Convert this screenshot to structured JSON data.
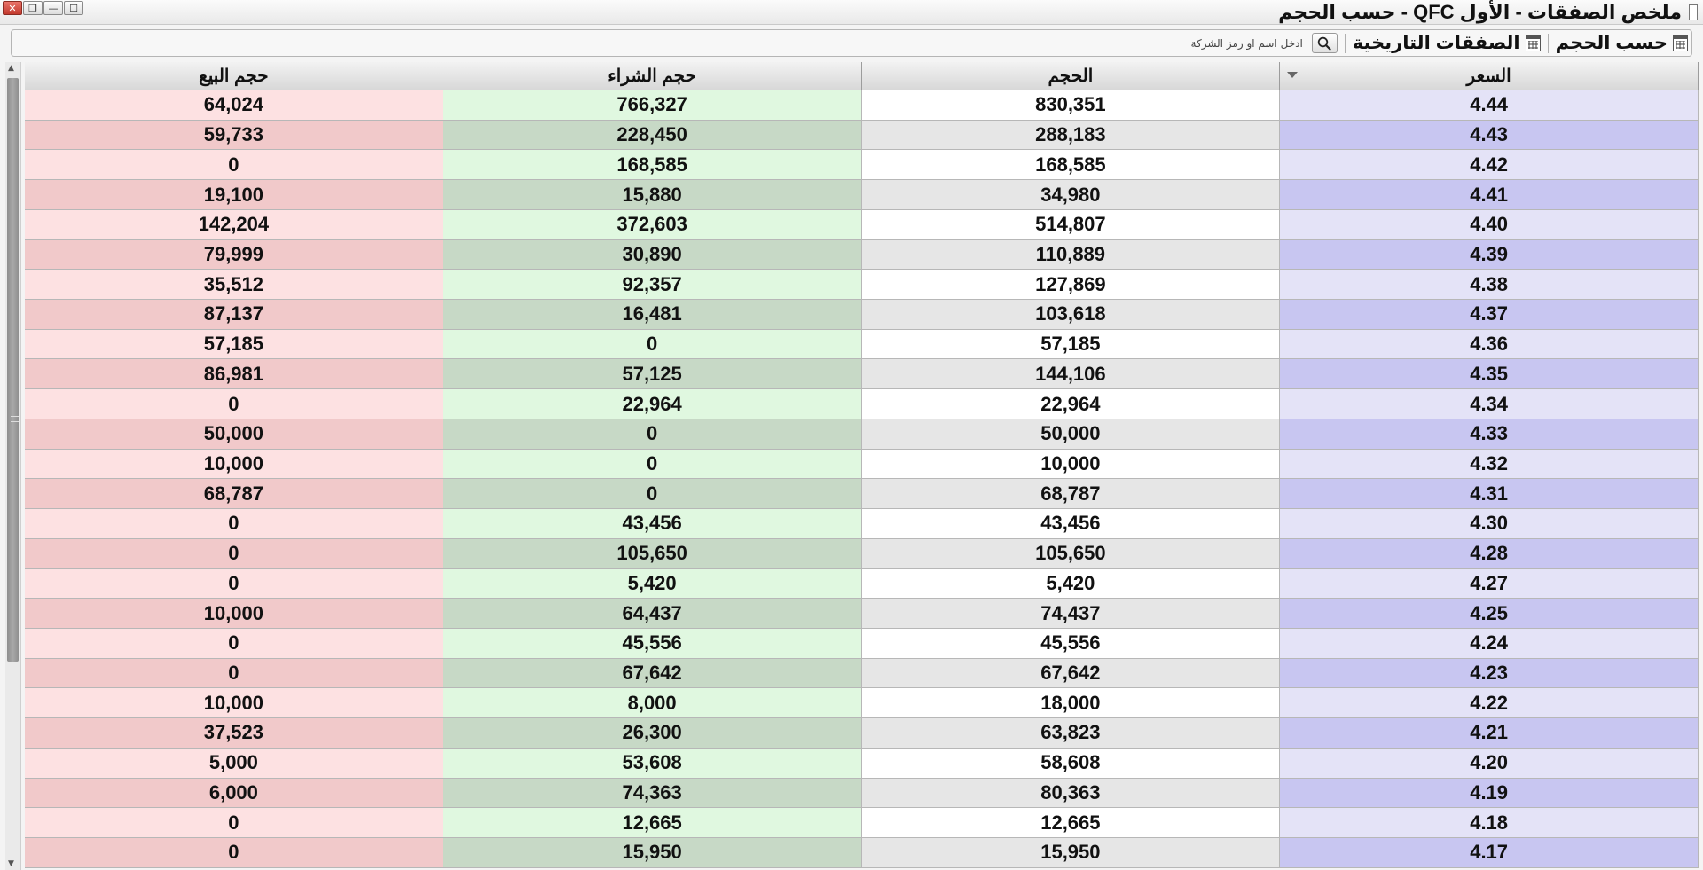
{
  "window": {
    "title": "ملخص الصفقات - الأول QFC - حسب الحجم",
    "controls": {
      "close": "✕",
      "restore": "❐",
      "minimize": "—",
      "maximize": "☐"
    }
  },
  "toolbar": {
    "by_volume_label": "حسب الحجم",
    "historical_trades_label": "الصفقات التاريخية",
    "search_placeholder": "ادخل اسم او رمز الشركة",
    "icons": [
      "calendar-icon",
      "search-icon"
    ]
  },
  "table": {
    "columns": [
      "حجم البيع",
      "حجم الشراء",
      "الحجم",
      "السعر"
    ],
    "sorted_column": "السعر",
    "rows": [
      {
        "sell": "64,024",
        "buy": "766,327",
        "volume": "830,351",
        "price": "4.44"
      },
      {
        "sell": "59,733",
        "buy": "228,450",
        "volume": "288,183",
        "price": "4.43"
      },
      {
        "sell": "0",
        "buy": "168,585",
        "volume": "168,585",
        "price": "4.42"
      },
      {
        "sell": "19,100",
        "buy": "15,880",
        "volume": "34,980",
        "price": "4.41"
      },
      {
        "sell": "142,204",
        "buy": "372,603",
        "volume": "514,807",
        "price": "4.40"
      },
      {
        "sell": "79,999",
        "buy": "30,890",
        "volume": "110,889",
        "price": "4.39"
      },
      {
        "sell": "35,512",
        "buy": "92,357",
        "volume": "127,869",
        "price": "4.38"
      },
      {
        "sell": "87,137",
        "buy": "16,481",
        "volume": "103,618",
        "price": "4.37"
      },
      {
        "sell": "57,185",
        "buy": "0",
        "volume": "57,185",
        "price": "4.36"
      },
      {
        "sell": "86,981",
        "buy": "57,125",
        "volume": "144,106",
        "price": "4.35"
      },
      {
        "sell": "0",
        "buy": "22,964",
        "volume": "22,964",
        "price": "4.34"
      },
      {
        "sell": "50,000",
        "buy": "0",
        "volume": "50,000",
        "price": "4.33"
      },
      {
        "sell": "10,000",
        "buy": "0",
        "volume": "10,000",
        "price": "4.32"
      },
      {
        "sell": "68,787",
        "buy": "0",
        "volume": "68,787",
        "price": "4.31"
      },
      {
        "sell": "0",
        "buy": "43,456",
        "volume": "43,456",
        "price": "4.30"
      },
      {
        "sell": "0",
        "buy": "105,650",
        "volume": "105,650",
        "price": "4.28"
      },
      {
        "sell": "0",
        "buy": "5,420",
        "volume": "5,420",
        "price": "4.27"
      },
      {
        "sell": "10,000",
        "buy": "64,437",
        "volume": "74,437",
        "price": "4.25"
      },
      {
        "sell": "0",
        "buy": "45,556",
        "volume": "45,556",
        "price": "4.24"
      },
      {
        "sell": "0",
        "buy": "67,642",
        "volume": "67,642",
        "price": "4.23"
      },
      {
        "sell": "10,000",
        "buy": "8,000",
        "volume": "18,000",
        "price": "4.22"
      },
      {
        "sell": "37,523",
        "buy": "26,300",
        "volume": "63,823",
        "price": "4.21"
      },
      {
        "sell": "5,000",
        "buy": "53,608",
        "volume": "58,608",
        "price": "4.20"
      },
      {
        "sell": "6,000",
        "buy": "74,363",
        "volume": "80,363",
        "price": "4.19"
      },
      {
        "sell": "0",
        "buy": "12,665",
        "volume": "12,665",
        "price": "4.18"
      },
      {
        "sell": "0",
        "buy": "15,950",
        "volume": "15,950",
        "price": "4.17"
      }
    ]
  },
  "scrollbar": {
    "up_arrow": "▲",
    "down_arrow": "▼"
  },
  "colors": {
    "sell_light": "#fde1e2",
    "sell_dark": "#f1c9ca",
    "buy_light": "#e0f8e0",
    "buy_dark": "#c7d9c6",
    "price_light": "#e4e3f7",
    "price_dark": "#c8c6f1"
  }
}
